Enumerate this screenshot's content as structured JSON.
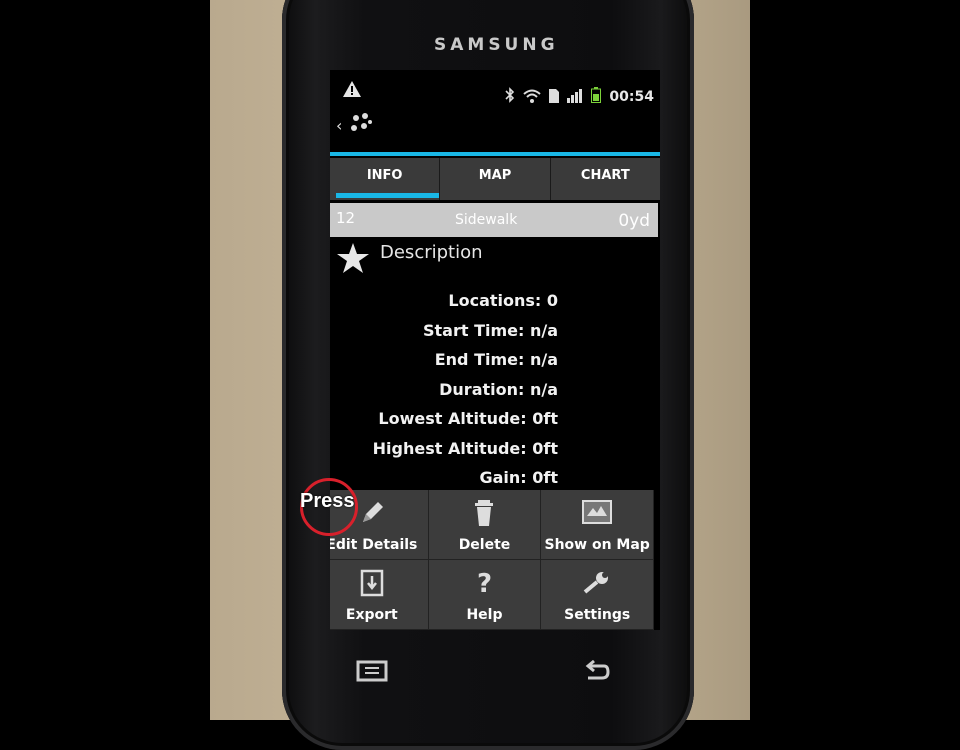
{
  "device": {
    "brand": "SAMSUNG"
  },
  "status_bar": {
    "time": "00:54"
  },
  "tabs": [
    {
      "label": "INFO",
      "active": true
    },
    {
      "label": "MAP",
      "active": false
    },
    {
      "label": "CHART",
      "active": false
    }
  ],
  "track": {
    "number": "12",
    "name": "Sidewalk",
    "distance": "0yd"
  },
  "description": {
    "label": "Description"
  },
  "stats": [
    "Locations: 0",
    "Start Time: n/a",
    "End Time: n/a",
    "Duration: n/a",
    "Lowest Altitude: 0ft",
    "Highest Altitude: 0ft",
    "Gain: 0ft"
  ],
  "menu": [
    {
      "label": "Edit Details",
      "icon": "pencil-icon"
    },
    {
      "label": "Delete",
      "icon": "trash-icon"
    },
    {
      "label": "Show on Map",
      "icon": "map-icon"
    },
    {
      "label": "Export",
      "icon": "export-icon"
    },
    {
      "label": "Help",
      "icon": "help-icon"
    },
    {
      "label": "Settings",
      "icon": "wrench-icon"
    }
  ],
  "annotation": {
    "text": "Press"
  },
  "colors": {
    "accent": "#19b7e6",
    "highlight": "#d8202b"
  }
}
